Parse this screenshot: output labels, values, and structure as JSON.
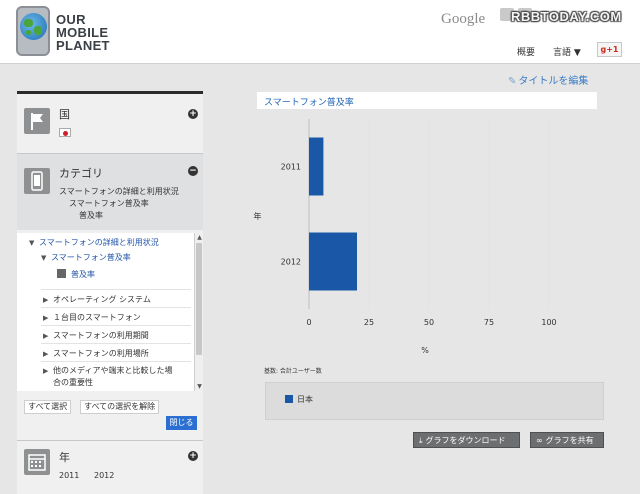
{
  "header": {
    "logo_lines": [
      "OUR",
      "MOBILE",
      "PLANET"
    ],
    "google_label": "Google",
    "watermark": "RBBTODAY.COM",
    "nav_overview": "概要",
    "nav_language": "言語 ▼",
    "gplus_label": "g+1"
  },
  "edit_title_label": "タイトルを編集",
  "sidebar": {
    "country": {
      "title": "国",
      "icon": "flag-icon",
      "selected_flag": "japan-flag-icon"
    },
    "category": {
      "title": "カテゴリ",
      "icon": "smartphone-icon",
      "path": [
        "スマートフォンの詳細と利用状況",
        "スマートフォン普及率",
        "普及率"
      ]
    },
    "tree": {
      "items": [
        {
          "label": "スマートフォンの詳細と利用状況",
          "marker": "▼",
          "selected": true
        },
        {
          "label": "スマートフォン普及率",
          "marker": "▼",
          "selected": true
        },
        {
          "label": "普及率",
          "marker": "■",
          "selected": true
        },
        {
          "label": "オペレーティング システム",
          "marker": "▶",
          "selected": false
        },
        {
          "label": "１台目のスマートフォン",
          "marker": "▶",
          "selected": false
        },
        {
          "label": "スマートフォンの利用期間",
          "marker": "▶",
          "selected": false
        },
        {
          "label": "スマートフォンの利用場所",
          "marker": "▶",
          "selected": false
        },
        {
          "label": "他のメディアや端末と比較した場",
          "marker": "▶",
          "selected": false
        },
        {
          "label": "合の重要性",
          "marker": "",
          "selected": false
        }
      ]
    },
    "select_all_label": "すべて選択",
    "deselect_all_label": "すべての選択を解除",
    "close_label": "閉じる",
    "year": {
      "title": "年",
      "icon": "calendar-icon",
      "values": [
        "2011",
        "2012"
      ]
    }
  },
  "main": {
    "base_label": "基数: 合計ユーザー数",
    "y_caption": "年",
    "download_label": "グラフをダウンロード",
    "share_label": "グラフを共有"
  },
  "chart_data": {
    "type": "bar",
    "orientation": "horizontal",
    "title": "スマートフォン普及率",
    "xlabel": "%",
    "ylabel": "年",
    "categories": [
      "2011",
      "2012"
    ],
    "series": [
      {
        "name": "日本",
        "values": [
          6,
          20
        ],
        "color": "#1a58a7"
      }
    ],
    "xlim": [
      0,
      100
    ],
    "x_ticks": [
      0,
      25,
      50,
      75,
      100
    ],
    "grid": true,
    "legend_placement": "bottom"
  }
}
